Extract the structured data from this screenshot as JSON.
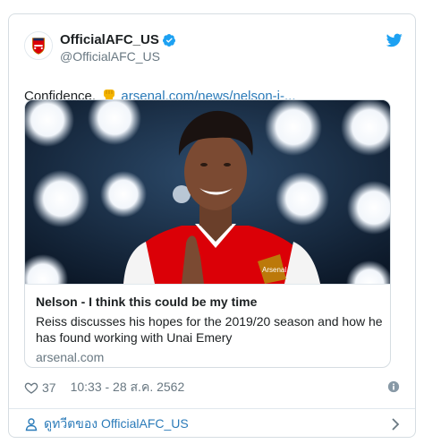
{
  "tweet": {
    "display_name": "OfficialAFC_US",
    "handle": "@OfficialAFC_US",
    "text": "Confidence.",
    "link_text": "arsenal.com/news/nelson-i-...",
    "card": {
      "title": "Nelson - I think this could be my time",
      "description": "Reiss discusses his hopes for the 2019/20 season and how he has found working with Unai Emery",
      "domain": "arsenal.com"
    },
    "like_count": "37",
    "timestamp": "10:33 - 28 ส.ค. 2562",
    "footer_link": "ดูทวีตของ OfficialAFC_US"
  },
  "colors": {
    "link": "#2b7bb9",
    "verified": "#1da1f2",
    "twitter_blue": "#1da1f2",
    "muted": "#697882",
    "arsenal_red": "#db0007"
  },
  "icons": [
    "arsenal-crest-icon",
    "verified-badge-icon",
    "twitter-bird-icon",
    "raised-fist-emoji-icon",
    "heart-icon",
    "info-icon",
    "person-icon",
    "chevron-right-icon"
  ]
}
